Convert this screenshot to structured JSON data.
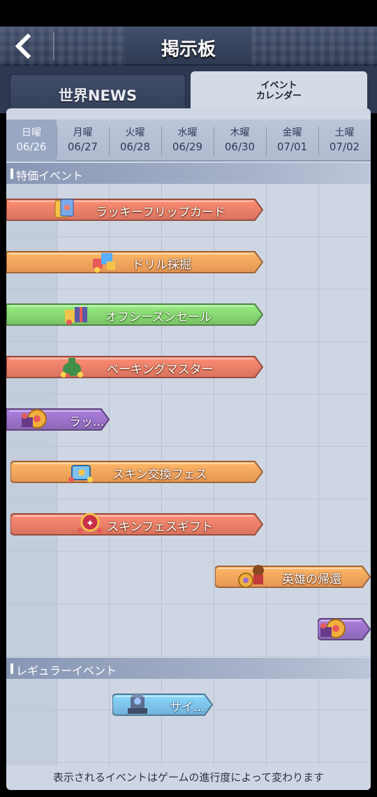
{
  "header": {
    "title": "掲示板"
  },
  "tabs": {
    "news": "世界NEWS",
    "calendar_line1": "イベント",
    "calendar_line2": "カレンダー"
  },
  "days": [
    {
      "name": "日曜",
      "date": "06/26",
      "today": true
    },
    {
      "name": "月曜",
      "date": "06/27",
      "today": false
    },
    {
      "name": "火曜",
      "date": "06/28",
      "today": false
    },
    {
      "name": "水曜",
      "date": "06/29",
      "today": false
    },
    {
      "name": "木曜",
      "date": "06/30",
      "today": false
    },
    {
      "name": "金曜",
      "date": "07/01",
      "today": false
    },
    {
      "name": "土曜",
      "date": "07/02",
      "today": false
    }
  ],
  "sections": {
    "special": "特価イベント",
    "regular": "レギュラーイベント"
  },
  "events": [
    {
      "label": "ラッキーフリップカード",
      "color": "#f07f68",
      "icon": "card-stack-icon"
    },
    {
      "label": "ドリル採掘",
      "color": "#fda55c",
      "icon": "drill-cubes-icon"
    },
    {
      "label": "オフシーズンセール",
      "color": "#86d672",
      "icon": "gift-boxes-icon"
    },
    {
      "label": "ベーキングマスター",
      "color": "#f07f68",
      "icon": "money-bag-icon"
    },
    {
      "label": "ラッ...",
      "color": "#9a72c9",
      "icon": "roulette-chest-icon"
    },
    {
      "label": "スキン交換フェス",
      "color": "#fda55c",
      "icon": "treasure-chest-icon"
    },
    {
      "label": "スキンフェスギフト",
      "color": "#f07f68",
      "icon": "badge-gift-icon"
    },
    {
      "label": "英雄の帰還",
      "color": "#fda55c",
      "icon": "hero-icon"
    },
    {
      "label": "",
      "color": "#9a72c9",
      "icon": "roulette-chest-icon"
    }
  ],
  "regular_events": [
    {
      "label": "サイ...",
      "color": "#7ec3f0",
      "icon": "tower-icon"
    }
  ],
  "footer": {
    "note": "表示されるイベントはゲームの進行度によって変わります"
  }
}
